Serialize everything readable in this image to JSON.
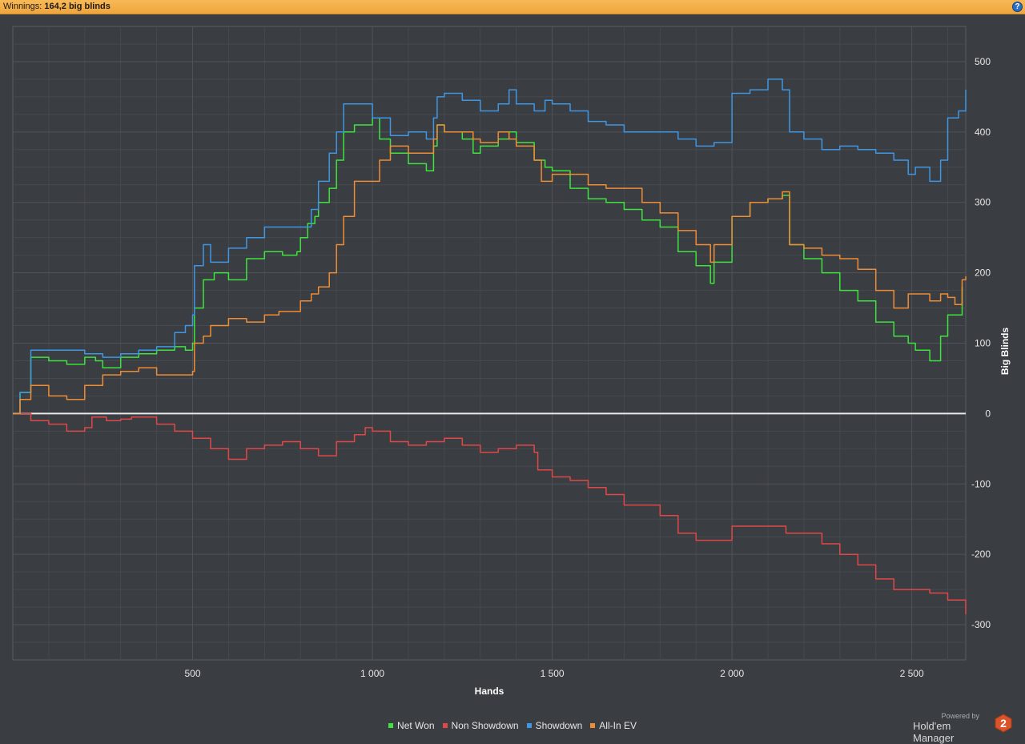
{
  "header": {
    "winnings_label": "Winnings:",
    "winnings_value": "164,2 big blinds",
    "help_glyph": "?"
  },
  "branding": {
    "powered_by": "Powered by",
    "product": "Hold'em Manager",
    "version": "2"
  },
  "colors": {
    "background": "#3a3d42",
    "grid": "#50545a",
    "zero_line": "#e8e8e8"
  },
  "chart_data": {
    "type": "line",
    "title": "",
    "xlabel": "Hands",
    "ylabel": "Big Blinds",
    "xlim": [
      0,
      2650
    ],
    "ylim": [
      -350,
      550
    ],
    "x_ticks": [
      500,
      1000,
      1500,
      2000,
      2500
    ],
    "x_tick_labels": [
      "500",
      "1 000",
      "1 500",
      "2 000",
      "2 500"
    ],
    "y_ticks": [
      -300,
      -200,
      -100,
      0,
      100,
      200,
      300,
      400,
      500
    ],
    "y_tick_labels": [
      "-300",
      "-200",
      "-100",
      "0",
      "100",
      "200",
      "300",
      "400",
      "500"
    ],
    "grid": true,
    "legend_position": "bottom-center",
    "series": [
      {
        "name": "Net Won",
        "color": "#3ee33e",
        "points": [
          [
            0,
            0
          ],
          [
            20,
            30
          ],
          [
            50,
            80
          ],
          [
            100,
            75
          ],
          [
            150,
            70
          ],
          [
            200,
            80
          ],
          [
            230,
            75
          ],
          [
            250,
            65
          ],
          [
            300,
            80
          ],
          [
            350,
            85
          ],
          [
            400,
            90
          ],
          [
            450,
            95
          ],
          [
            480,
            90
          ],
          [
            500,
            100
          ],
          [
            505,
            150
          ],
          [
            530,
            190
          ],
          [
            560,
            200
          ],
          [
            600,
            190
          ],
          [
            650,
            220
          ],
          [
            700,
            230
          ],
          [
            750,
            225
          ],
          [
            790,
            230
          ],
          [
            800,
            250
          ],
          [
            820,
            270
          ],
          [
            840,
            280
          ],
          [
            850,
            300
          ],
          [
            880,
            320
          ],
          [
            900,
            360
          ],
          [
            920,
            400
          ],
          [
            950,
            410
          ],
          [
            1000,
            420
          ],
          [
            1020,
            390
          ],
          [
            1050,
            370
          ],
          [
            1100,
            355
          ],
          [
            1150,
            345
          ],
          [
            1170,
            380
          ],
          [
            1180,
            410
          ],
          [
            1200,
            400
          ],
          [
            1250,
            390
          ],
          [
            1280,
            370
          ],
          [
            1300,
            380
          ],
          [
            1350,
            390
          ],
          [
            1380,
            400
          ],
          [
            1400,
            385
          ],
          [
            1450,
            360
          ],
          [
            1480,
            350
          ],
          [
            1500,
            345
          ],
          [
            1550,
            320
          ],
          [
            1600,
            305
          ],
          [
            1650,
            300
          ],
          [
            1700,
            290
          ],
          [
            1750,
            275
          ],
          [
            1800,
            265
          ],
          [
            1850,
            230
          ],
          [
            1900,
            210
          ],
          [
            1940,
            185
          ],
          [
            1950,
            215
          ],
          [
            2000,
            280
          ],
          [
            2050,
            300
          ],
          [
            2100,
            305
          ],
          [
            2140,
            310
          ],
          [
            2160,
            240
          ],
          [
            2200,
            220
          ],
          [
            2250,
            200
          ],
          [
            2300,
            175
          ],
          [
            2350,
            160
          ],
          [
            2400,
            130
          ],
          [
            2450,
            110
          ],
          [
            2490,
            100
          ],
          [
            2510,
            90
          ],
          [
            2550,
            75
          ],
          [
            2580,
            110
          ],
          [
            2600,
            140
          ],
          [
            2620,
            140
          ],
          [
            2640,
            180
          ]
        ]
      },
      {
        "name": "Non Showdown",
        "color": "#e04848",
        "points": [
          [
            0,
            0
          ],
          [
            50,
            -10
          ],
          [
            100,
            -15
          ],
          [
            150,
            -25
          ],
          [
            200,
            -20
          ],
          [
            220,
            -5
          ],
          [
            260,
            -10
          ],
          [
            300,
            -8
          ],
          [
            330,
            -5
          ],
          [
            360,
            -5
          ],
          [
            400,
            -15
          ],
          [
            450,
            -25
          ],
          [
            500,
            -35
          ],
          [
            550,
            -50
          ],
          [
            600,
            -65
          ],
          [
            650,
            -50
          ],
          [
            700,
            -45
          ],
          [
            750,
            -40
          ],
          [
            800,
            -50
          ],
          [
            850,
            -60
          ],
          [
            880,
            -60
          ],
          [
            900,
            -40
          ],
          [
            950,
            -30
          ],
          [
            980,
            -20
          ],
          [
            1000,
            -25
          ],
          [
            1050,
            -40
          ],
          [
            1100,
            -45
          ],
          [
            1150,
            -40
          ],
          [
            1200,
            -35
          ],
          [
            1250,
            -45
          ],
          [
            1300,
            -55
          ],
          [
            1350,
            -50
          ],
          [
            1400,
            -45
          ],
          [
            1450,
            -55
          ],
          [
            1460,
            -80
          ],
          [
            1500,
            -90
          ],
          [
            1550,
            -95
          ],
          [
            1600,
            -105
          ],
          [
            1650,
            -115
          ],
          [
            1700,
            -130
          ],
          [
            1750,
            -130
          ],
          [
            1800,
            -145
          ],
          [
            1850,
            -170
          ],
          [
            1900,
            -180
          ],
          [
            1950,
            -180
          ],
          [
            2000,
            -160
          ],
          [
            2050,
            -160
          ],
          [
            2100,
            -160
          ],
          [
            2150,
            -170
          ],
          [
            2200,
            -170
          ],
          [
            2250,
            -185
          ],
          [
            2300,
            -200
          ],
          [
            2350,
            -215
          ],
          [
            2400,
            -235
          ],
          [
            2450,
            -250
          ],
          [
            2500,
            -250
          ],
          [
            2550,
            -255
          ],
          [
            2600,
            -265
          ],
          [
            2650,
            -285
          ]
        ]
      },
      {
        "name": "Showdown",
        "color": "#3f96e3",
        "points": [
          [
            0,
            0
          ],
          [
            20,
            30
          ],
          [
            50,
            90
          ],
          [
            100,
            90
          ],
          [
            150,
            90
          ],
          [
            200,
            85
          ],
          [
            250,
            80
          ],
          [
            300,
            85
          ],
          [
            350,
            90
          ],
          [
            400,
            95
          ],
          [
            450,
            115
          ],
          [
            480,
            125
          ],
          [
            500,
            140
          ],
          [
            505,
            210
          ],
          [
            530,
            240
          ],
          [
            550,
            215
          ],
          [
            600,
            235
          ],
          [
            650,
            250
          ],
          [
            700,
            265
          ],
          [
            740,
            265
          ],
          [
            800,
            265
          ],
          [
            830,
            290
          ],
          [
            850,
            330
          ],
          [
            880,
            370
          ],
          [
            900,
            400
          ],
          [
            920,
            440
          ],
          [
            950,
            440
          ],
          [
            1000,
            420
          ],
          [
            1020,
            420
          ],
          [
            1050,
            395
          ],
          [
            1100,
            400
          ],
          [
            1150,
            390
          ],
          [
            1170,
            420
          ],
          [
            1180,
            450
          ],
          [
            1200,
            455
          ],
          [
            1250,
            445
          ],
          [
            1300,
            430
          ],
          [
            1350,
            440
          ],
          [
            1380,
            460
          ],
          [
            1400,
            440
          ],
          [
            1450,
            430
          ],
          [
            1480,
            445
          ],
          [
            1500,
            440
          ],
          [
            1550,
            430
          ],
          [
            1600,
            415
          ],
          [
            1650,
            410
          ],
          [
            1700,
            400
          ],
          [
            1750,
            400
          ],
          [
            1800,
            400
          ],
          [
            1850,
            390
          ],
          [
            1900,
            380
          ],
          [
            1950,
            385
          ],
          [
            2000,
            455
          ],
          [
            2050,
            460
          ],
          [
            2100,
            475
          ],
          [
            2140,
            460
          ],
          [
            2160,
            400
          ],
          [
            2200,
            390
          ],
          [
            2250,
            375
          ],
          [
            2300,
            380
          ],
          [
            2350,
            375
          ],
          [
            2400,
            370
          ],
          [
            2450,
            360
          ],
          [
            2490,
            340
          ],
          [
            2510,
            350
          ],
          [
            2550,
            330
          ],
          [
            2580,
            360
          ],
          [
            2600,
            420
          ],
          [
            2630,
            430
          ],
          [
            2650,
            460
          ]
        ]
      },
      {
        "name": "All-In EV",
        "color": "#ef8d34",
        "points": [
          [
            0,
            0
          ],
          [
            20,
            20
          ],
          [
            50,
            40
          ],
          [
            100,
            25
          ],
          [
            150,
            20
          ],
          [
            200,
            40
          ],
          [
            250,
            55
          ],
          [
            300,
            60
          ],
          [
            350,
            65
          ],
          [
            400,
            55
          ],
          [
            450,
            55
          ],
          [
            500,
            60
          ],
          [
            505,
            100
          ],
          [
            530,
            110
          ],
          [
            550,
            125
          ],
          [
            600,
            135
          ],
          [
            650,
            130
          ],
          [
            700,
            140
          ],
          [
            740,
            145
          ],
          [
            800,
            160
          ],
          [
            830,
            170
          ],
          [
            850,
            180
          ],
          [
            880,
            200
          ],
          [
            900,
            240
          ],
          [
            920,
            280
          ],
          [
            950,
            330
          ],
          [
            1000,
            330
          ],
          [
            1020,
            360
          ],
          [
            1050,
            380
          ],
          [
            1100,
            370
          ],
          [
            1150,
            370
          ],
          [
            1170,
            390
          ],
          [
            1180,
            410
          ],
          [
            1200,
            400
          ],
          [
            1250,
            400
          ],
          [
            1280,
            390
          ],
          [
            1300,
            385
          ],
          [
            1350,
            400
          ],
          [
            1380,
            390
          ],
          [
            1400,
            380
          ],
          [
            1450,
            360
          ],
          [
            1470,
            330
          ],
          [
            1500,
            340
          ],
          [
            1550,
            340
          ],
          [
            1600,
            325
          ],
          [
            1650,
            320
          ],
          [
            1700,
            320
          ],
          [
            1750,
            300
          ],
          [
            1800,
            285
          ],
          [
            1850,
            260
          ],
          [
            1900,
            240
          ],
          [
            1940,
            215
          ],
          [
            1950,
            240
          ],
          [
            2000,
            280
          ],
          [
            2050,
            300
          ],
          [
            2100,
            305
          ],
          [
            2140,
            315
          ],
          [
            2160,
            240
          ],
          [
            2200,
            235
          ],
          [
            2250,
            225
          ],
          [
            2300,
            220
          ],
          [
            2350,
            205
          ],
          [
            2400,
            175
          ],
          [
            2450,
            150
          ],
          [
            2490,
            170
          ],
          [
            2510,
            170
          ],
          [
            2550,
            160
          ],
          [
            2580,
            170
          ],
          [
            2600,
            165
          ],
          [
            2620,
            155
          ],
          [
            2640,
            190
          ],
          [
            2650,
            195
          ]
        ]
      }
    ]
  }
}
